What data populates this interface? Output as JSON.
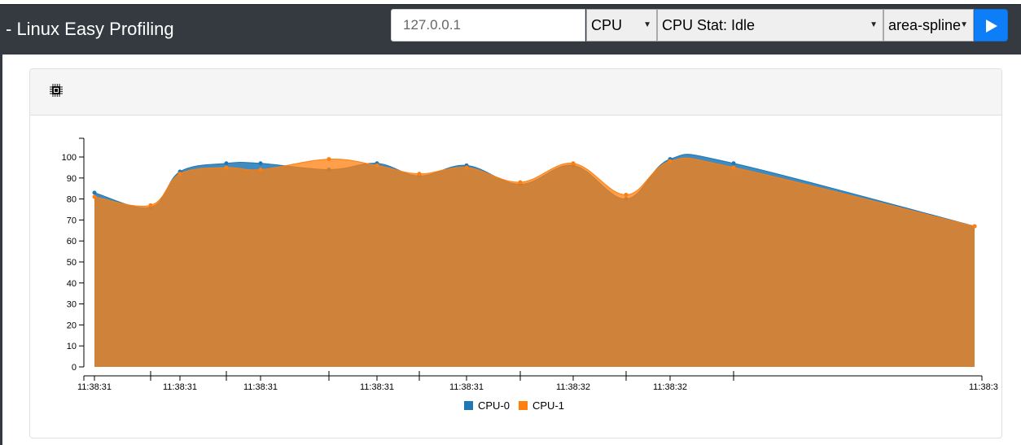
{
  "app": {
    "title": "- Linux Easy Profiling"
  },
  "controls": {
    "host": {
      "value": "127.0.0.1"
    },
    "metric_kind": {
      "selected": "CPU"
    },
    "metric_stat": {
      "selected": "CPU Stat: Idle"
    },
    "chart_type": {
      "selected": "area-spline"
    },
    "run_icon": "play-icon"
  },
  "card": {
    "header_icon": "cpu-chip-icon"
  },
  "colors": {
    "topbar": "#343a40",
    "accent": "#0d7ef7",
    "series0": "#1f77b4",
    "series1": "#ff7f0e"
  },
  "chart_data": {
    "type": "area",
    "x": [
      "",
      "11:38:31",
      "",
      "11:38:31",
      "",
      "11:38:31",
      "",
      "11:38:31",
      "",
      "",
      "11:38:32",
      "",
      "11:38:32",
      "",
      "",
      "11:38:3"
    ],
    "x_tick_labels": [
      "11:38:31",
      "11:38:31",
      "11:38:31",
      "11:38:31",
      "11:38:31",
      "11:38:32",
      "11:38:32",
      "11:38:3"
    ],
    "series": [
      {
        "name": "CPU-0",
        "color": "#1f77b4",
        "values": [
          83,
          76,
          93,
          97,
          97,
          94,
          97,
          91,
          96,
          87,
          96,
          80,
          99,
          97,
          67
        ]
      },
      {
        "name": "CPU-1",
        "color": "#ff7f0e",
        "values": [
          81,
          77,
          92,
          95,
          94,
          99,
          96,
          92,
          95,
          88,
          97,
          82,
          98,
          95,
          67
        ]
      }
    ],
    "ylim": [
      0,
      100
    ],
    "y_ticks": [
      0,
      10,
      20,
      30,
      40,
      50,
      60,
      70,
      80,
      90,
      100
    ],
    "legend": "bottom-center",
    "grid": false
  }
}
